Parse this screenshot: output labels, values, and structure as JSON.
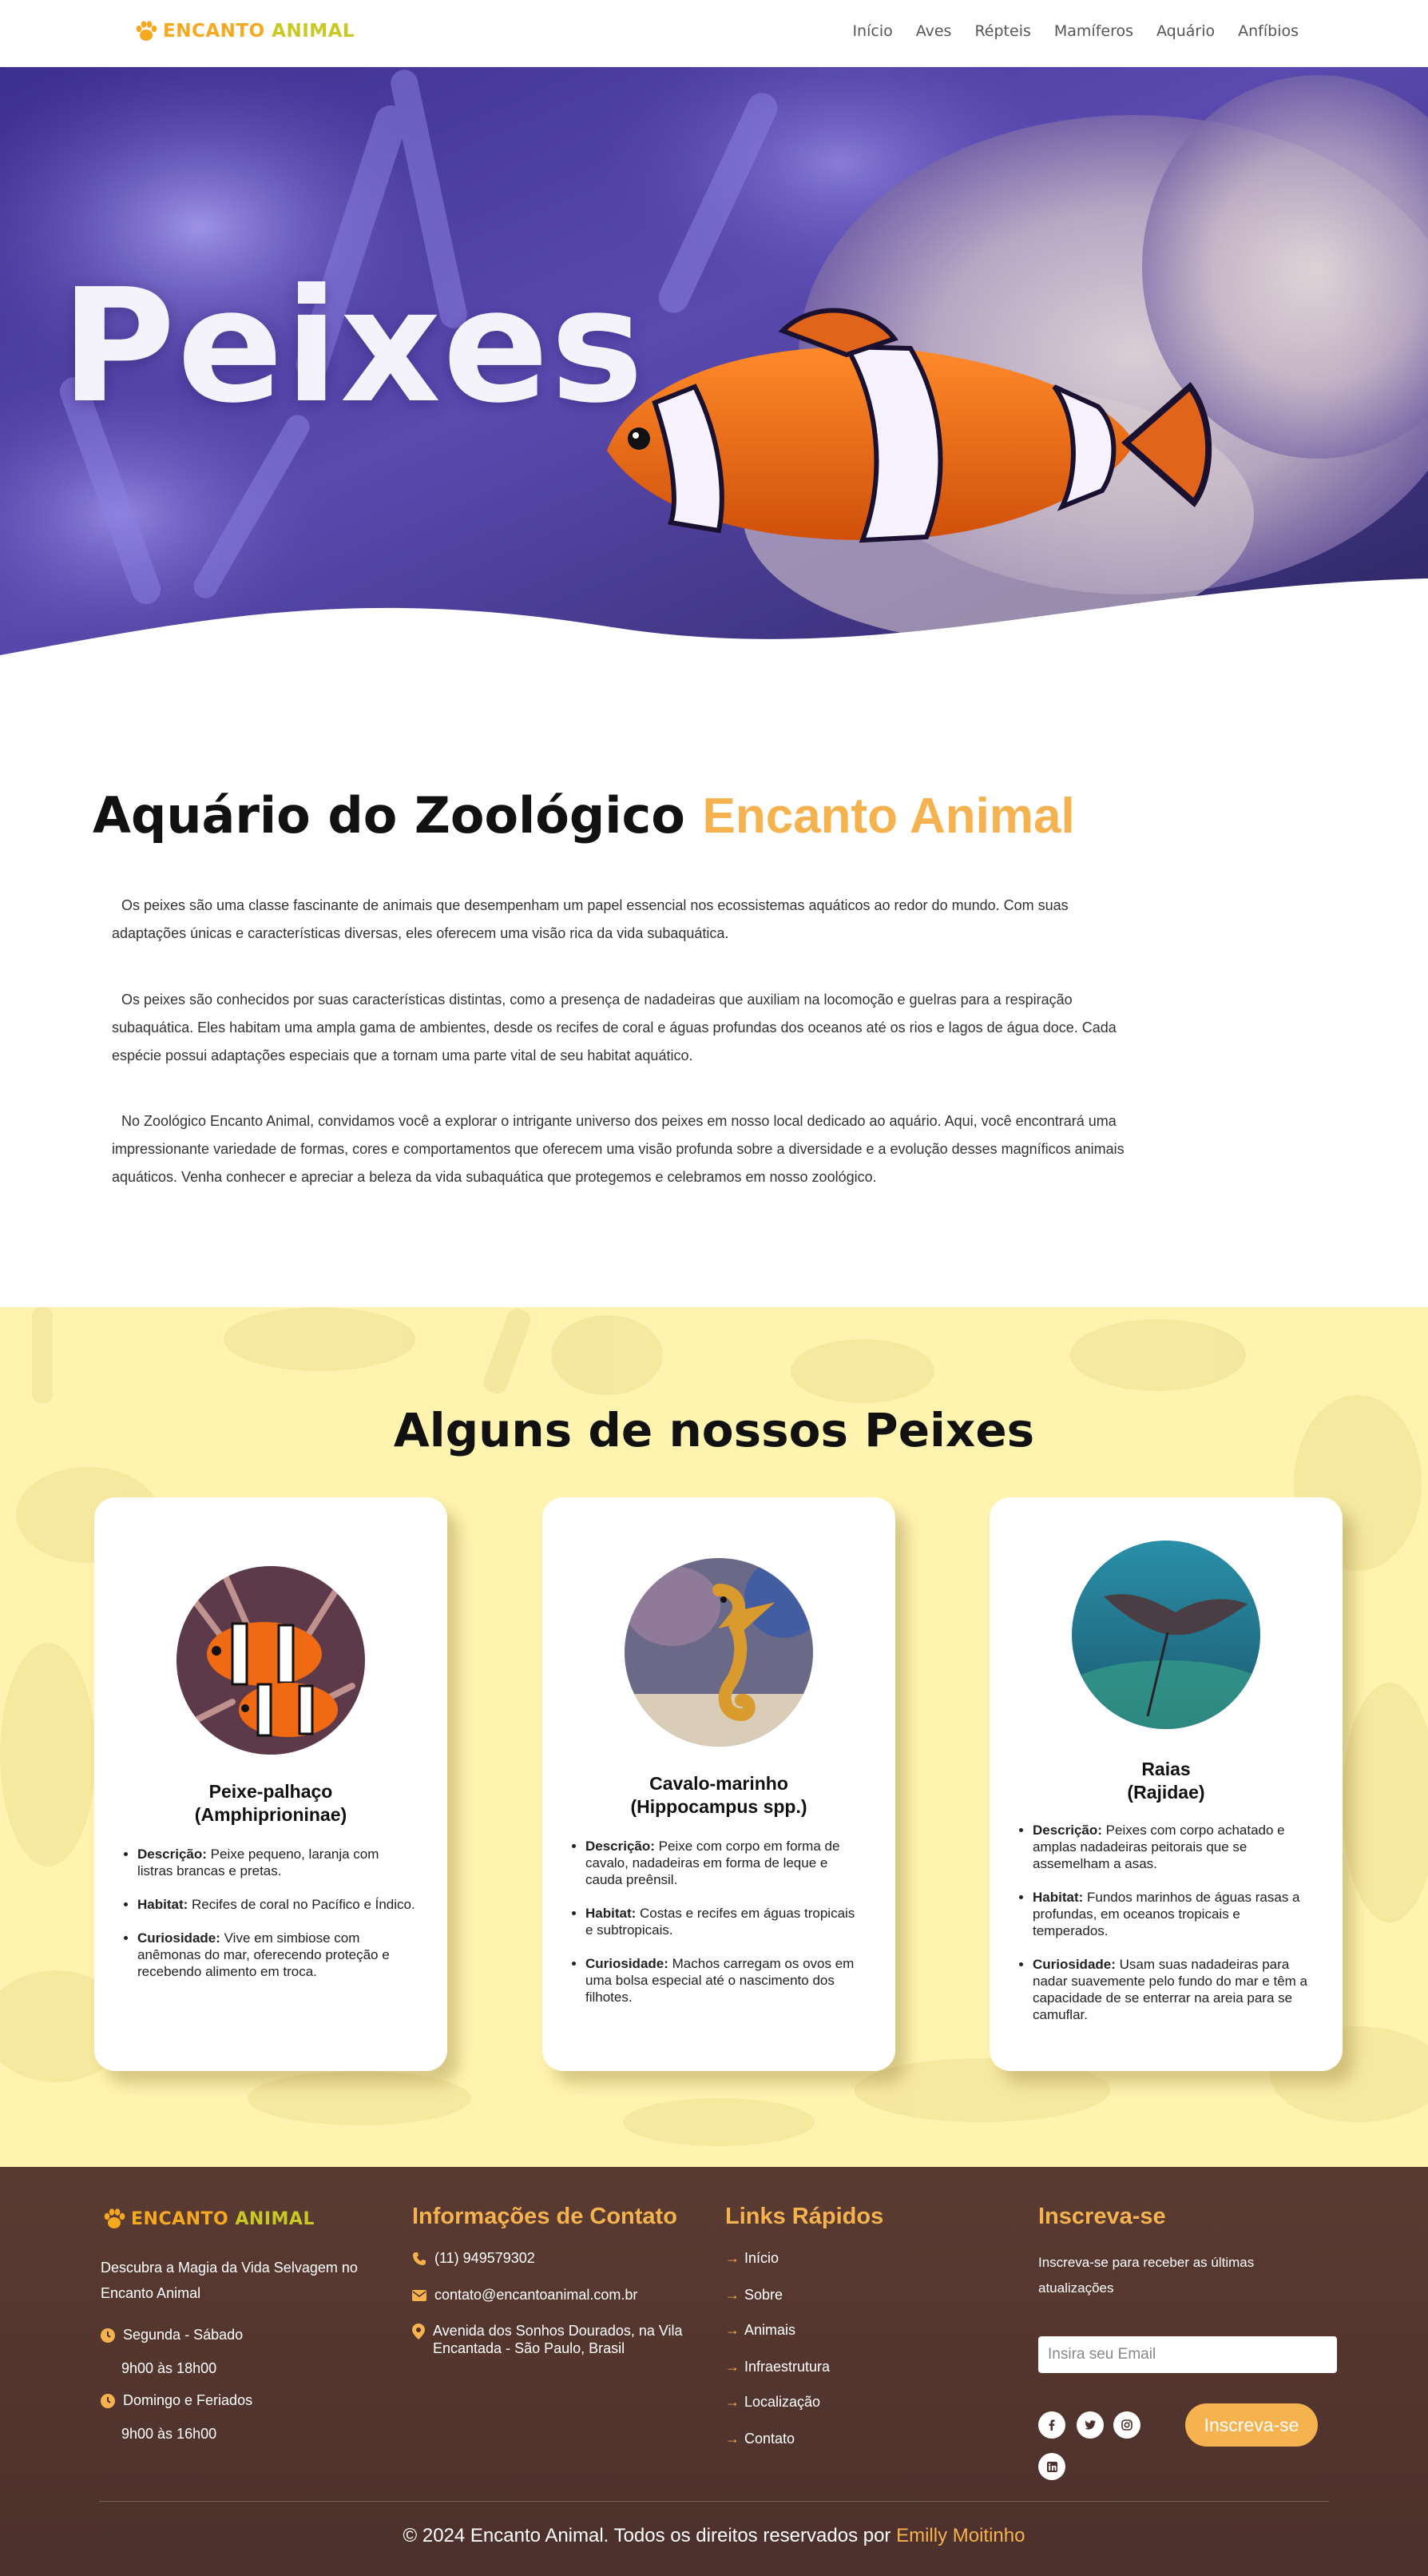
{
  "brand": {
    "name_part1": "ENCANTO ",
    "name_part2": "ANIMAL"
  },
  "nav": {
    "items": [
      "Início",
      "Aves",
      "Répteis",
      "Mamíferos",
      "Aquário",
      "Anfíbios"
    ]
  },
  "hero": {
    "title": "Peixes"
  },
  "intro": {
    "title_main": "Aquário do Zoológico ",
    "title_accent": "Encanto Animal",
    "paragraphs": [
      "Os peixes são uma classe fascinante de animais que desempenham um papel essencial nos ecossistemas aquáticos ao redor do mundo. Com suas adaptações únicas e características diversas, eles oferecem uma visão rica da vida subaquática.",
      "Os peixes são conhecidos por suas características distintas, como a presença de nadadeiras que auxiliam na locomoção e guelras para a respiração subaquática. Eles habitam uma ampla gama de ambientes, desde os recifes de coral e águas profundas dos oceanos até os rios e lagos de água doce. Cada espécie possui adaptações especiais que a tornam uma parte vital de seu habitat aquático.",
      "No Zoológico Encanto Animal, convidamos você a explorar o intrigante universo dos peixes em nosso local dedicado ao aquário. Aqui, você encontrará uma impressionante variedade de formas, cores e comportamentos que oferecem uma visão profunda sobre a diversidade e a evolução desses magníficos animais aquáticos. Venha conhecer e apreciar a beleza da vida subaquática que protegemos e celebramos em nosso zoológico."
    ]
  },
  "fish_section": {
    "title": "Alguns de nossos Peixes",
    "labels": {
      "desc": "Descrição:",
      "habitat": "Habitat:",
      "curio": "Curiosidade:"
    },
    "cards": [
      {
        "name": "Peixe-palhaço",
        "scientific": "(Amphiprioninae)",
        "desc": "Peixe pequeno, laranja com listras brancas e pretas.",
        "habitat": "Recifes de coral no Pacífico e Índico.",
        "curio": "Vive em simbiose com anêmonas do mar, oferecendo proteção e recebendo alimento em troca."
      },
      {
        "name": "Cavalo-marinho",
        "scientific": "(Hippocampus spp.)",
        "desc": "Peixe com corpo em forma de cavalo, nadadeiras em forma de leque e cauda preênsil.",
        "habitat": "Costas e recifes em águas tropicais e subtropicais.",
        "curio": "Machos carregam os ovos em uma bolsa especial até o nascimento dos filhotes."
      },
      {
        "name": "Raias",
        "scientific": "(Rajidae)",
        "desc": "Peixes com corpo achatado e amplas nadadeiras peitorais que se assemelham a asas.",
        "habitat": "Fundos marinhos de águas rasas a profundas, em oceanos tropicais e temperados.",
        "curio": "Usam suas nadadeiras para nadar suavemente pelo fundo do mar e têm a capacidade de se enterrar na areia para se camuflar."
      }
    ]
  },
  "footer": {
    "tagline": "Descubra a Magia da Vida Selvagem no Encanto Animal",
    "hours": [
      {
        "label": "Segunda - Sábado",
        "time": "9h00 às 18h00"
      },
      {
        "label": "Domingo e Feriados",
        "time": "9h00 às 16h00"
      }
    ],
    "contact_title": "Informações de Contato",
    "phone": "(11) 949579302",
    "email": "contato@encantoanimal.com.br",
    "address": "Avenida dos Sonhos Dourados, na Vila Encantada - São Paulo, Brasil",
    "links_title": "Links Rápidos",
    "links": [
      "Início",
      "Sobre",
      "Animais",
      "Infraestrutura",
      "Localização",
      "Contato"
    ],
    "subscribe_title": "Inscreva-se",
    "subscribe_text": "Inscreva-se para receber as últimas atualizações",
    "email_placeholder": "Insira seu Email",
    "subscribe_button": "Inscreva-se",
    "social": [
      "facebook-icon",
      "twitter-icon",
      "instagram-icon",
      "linkedin-icon"
    ],
    "copyright": "© 2024 Encanto Animal. Todos os direitos reservados por ",
    "author": "Emilly Moitinho"
  },
  "colors": {
    "accent": "#f6b24e",
    "section_bg": "#fff3b0",
    "footer_bg": "#56382f",
    "nav_text": "#555555"
  }
}
